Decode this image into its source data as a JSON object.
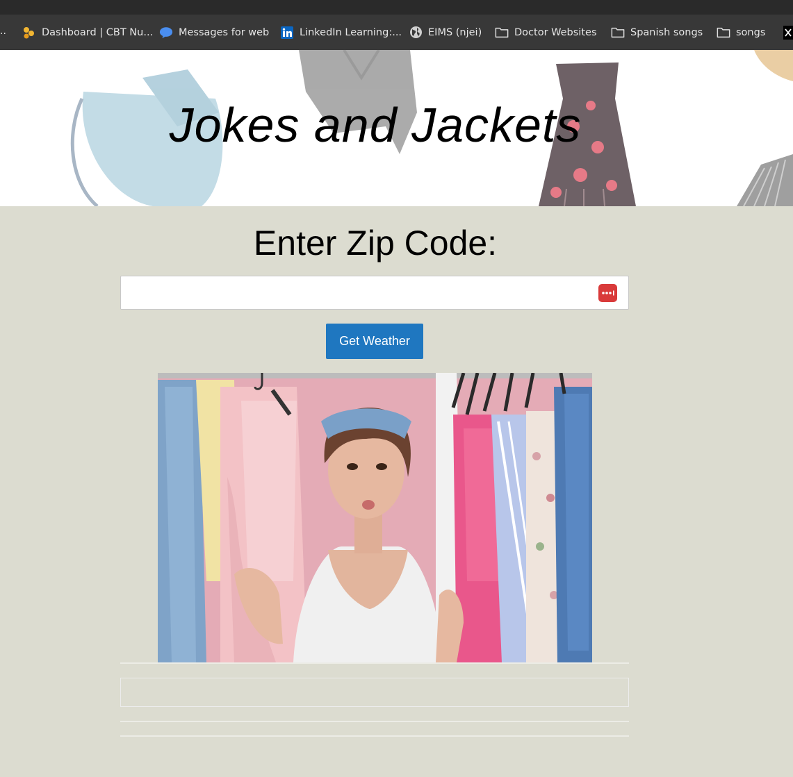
{
  "bookmarks": [
    {
      "label": "Dashboard | CBT Nu...",
      "icon": "cbt-nuggets-icon"
    },
    {
      "label": "Messages for web",
      "icon": "messages-icon"
    },
    {
      "label": "LinkedIn Learning:...",
      "icon": "linkedin-icon"
    },
    {
      "label": "EIMS (njei)",
      "icon": "globe-icon"
    },
    {
      "label": "Doctor Websites",
      "icon": "folder-icon"
    },
    {
      "label": "Spanish songs",
      "icon": "folder-icon"
    },
    {
      "label": "songs",
      "icon": "folder-icon"
    }
  ],
  "bookmarks_overflow": "..",
  "site": {
    "title": "Jokes and Jackets"
  },
  "form": {
    "heading": "Enter Zip Code:",
    "zip_value": "",
    "button_label": "Get Weather"
  },
  "colors": {
    "page_background": "#dcdcd0",
    "button": "#1f77c0",
    "password_icon": "#d93a3a"
  }
}
